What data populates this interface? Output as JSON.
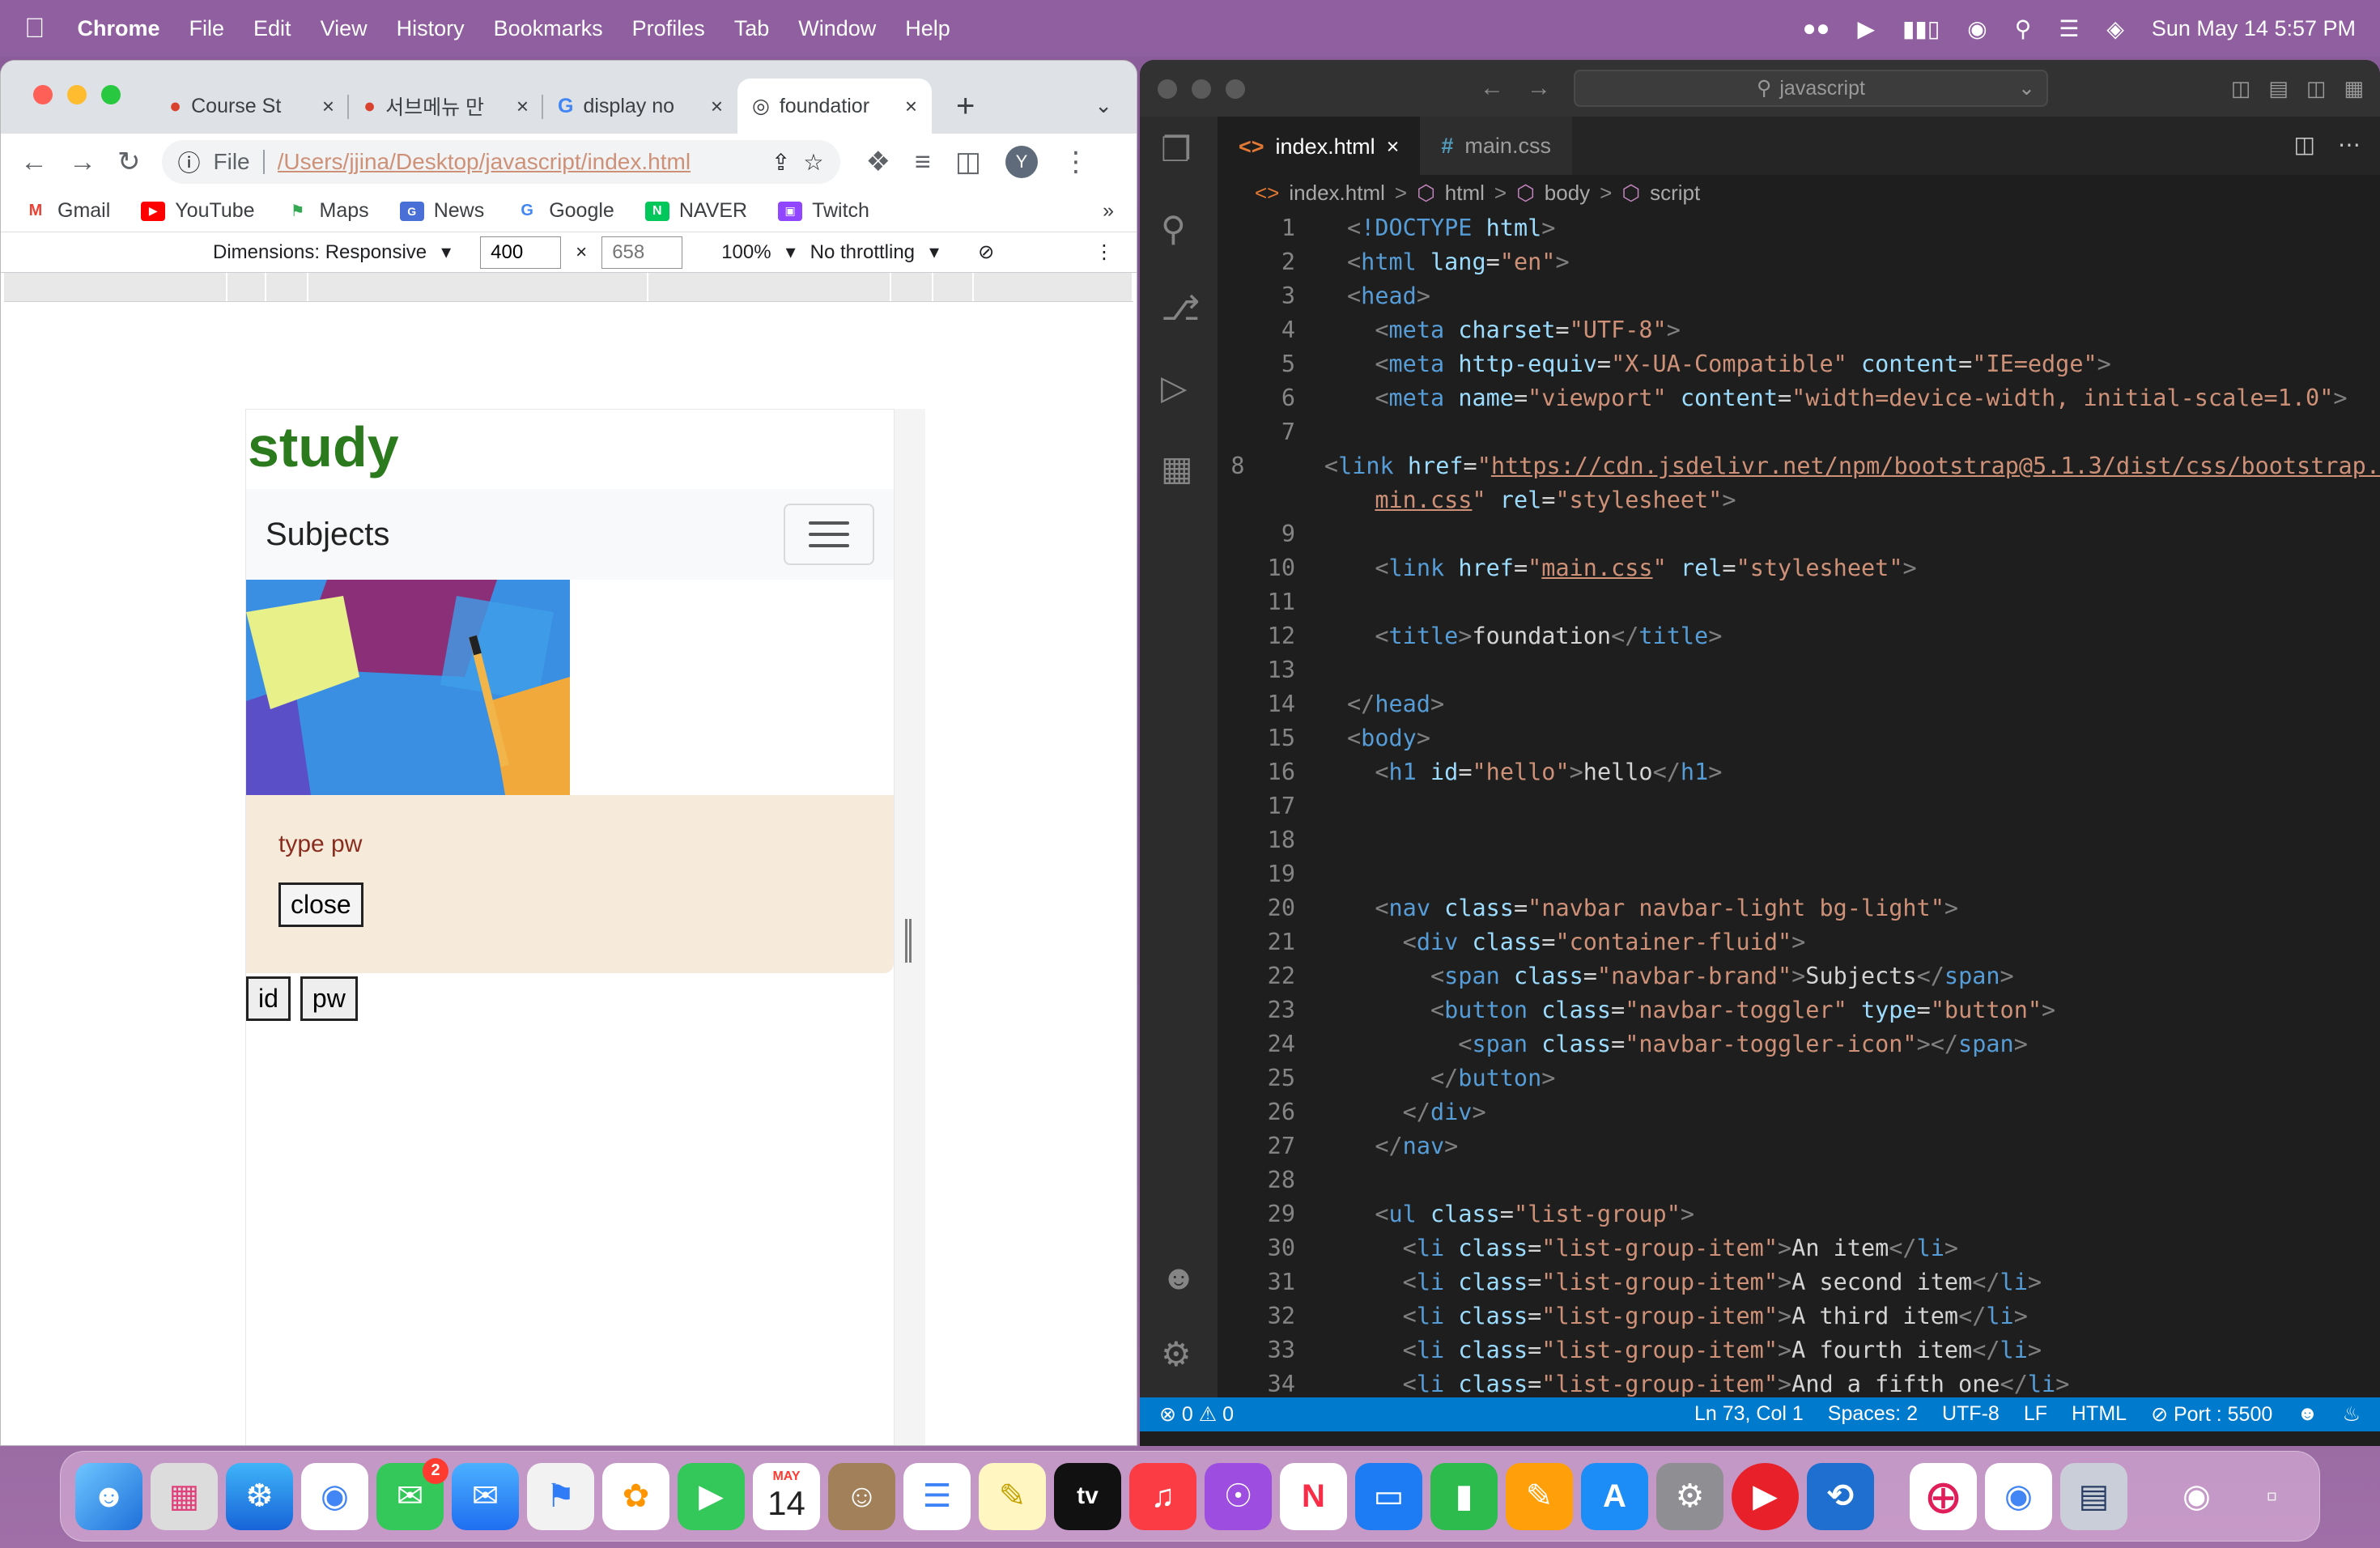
{
  "menubar": {
    "app_name": "Chrome",
    "menus": [
      "File",
      "Edit",
      "View",
      "History",
      "Bookmarks",
      "Profiles",
      "Tab",
      "Window",
      "Help"
    ],
    "clock": "Sun May 14  5:57 PM"
  },
  "chrome": {
    "tabs": [
      {
        "label": "Course St"
      },
      {
        "label": "서브메뉴 만"
      },
      {
        "label": "display no"
      },
      {
        "label": "foundatior"
      }
    ],
    "new_tab": "+",
    "address": {
      "scheme": "File",
      "url": "/Users/jjina/Desktop/javascript/index.html"
    },
    "avatar_letter": "Y",
    "bookmarks": [
      "Gmail",
      "YouTube",
      "Maps",
      "News",
      "Google",
      "NAVER",
      "Twitch"
    ],
    "bookmarks_more": "»",
    "devtools": {
      "dimensions_label": "Dimensions: Responsive",
      "width": "400",
      "times": "×",
      "height": "658",
      "zoom": "100%",
      "throttling": "No throttling"
    }
  },
  "page": {
    "heading": "study",
    "navbar_brand": "Subjects",
    "alert_text": "type pw",
    "close_button": "close",
    "id_button": "id",
    "pw_button": "pw"
  },
  "vscode": {
    "search": "javascript",
    "tabs": [
      {
        "label": "index.html",
        "icon": "<>",
        "close": "×"
      },
      {
        "label": "main.css",
        "icon": "#"
      }
    ],
    "breadcrumb": [
      "index.html",
      "html",
      "body",
      "script"
    ],
    "breadcrumb_sep": ">",
    "status": {
      "problems": "⊗ 0 ⚠ 0",
      "position": "Ln 73, Col 1",
      "spaces": "Spaces: 2",
      "encoding": "UTF-8",
      "eol": "LF",
      "language": "HTML",
      "port": "⊘ Port : 5500"
    },
    "line_numbers": [
      "1",
      "2",
      "3",
      "4",
      "5",
      "6",
      "7",
      "8",
      "",
      "9",
      "10",
      "11",
      "12",
      "13",
      "14",
      "15",
      "16",
      "17",
      "18",
      "19",
      "20",
      "21",
      "22",
      "23",
      "24",
      "25",
      "26",
      "27",
      "28",
      "29",
      "30",
      "31",
      "32",
      "33",
      "34"
    ]
  },
  "dock": {
    "calendar_month": "MAY",
    "calendar_day": "14",
    "messages_badge": "2",
    "appletv_label": "tv"
  }
}
